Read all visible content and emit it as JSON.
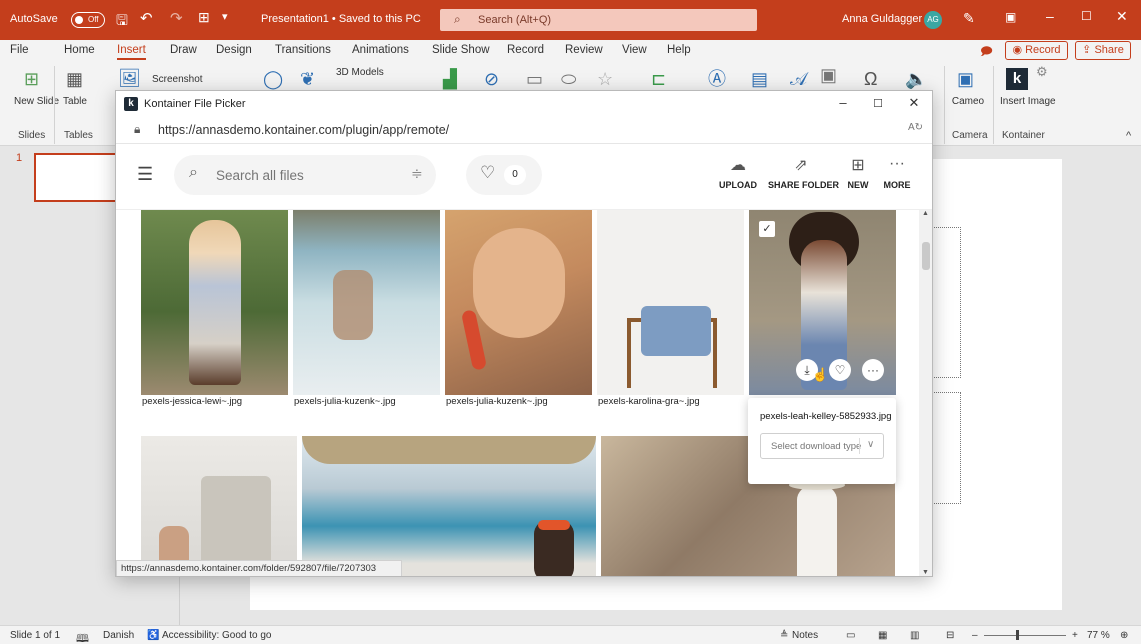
{
  "titlebar": {
    "autosave_label": "AutoSave",
    "autosave_state": "Off",
    "doc_title": "Presentation1 • Saved to this PC",
    "search_placeholder": "Search (Alt+Q)",
    "user_name": "Anna Guldagger",
    "user_initials": "AG"
  },
  "menu": {
    "items": [
      "File",
      "Home",
      "Insert",
      "Draw",
      "Design",
      "Transitions",
      "Animations",
      "Slide Show",
      "Record",
      "Review",
      "View",
      "Help"
    ],
    "active": "Insert",
    "record_label": "Record",
    "share_label": "Share"
  },
  "ribbon": {
    "new_slide": "New Slide",
    "table": "Table",
    "screenshot": "Screenshot",
    "models_3d": "3D Models",
    "cameo": "Cameo",
    "insert_image": "Insert Image",
    "groups": {
      "slides": "Slides",
      "tables": "Tables",
      "camera": "Camera",
      "kontainer": "Kontainer"
    }
  },
  "picker": {
    "window_title": "Kontainer File Picker",
    "url": "https://annasdemo.kontainer.com/plugin/app/remote/",
    "search_placeholder": "Search all files",
    "favorites_count": "0",
    "tools": {
      "upload": "UPLOAD",
      "share_folder": "SHARE FOLDER",
      "new": "NEW",
      "more": "MORE"
    },
    "files": [
      {
        "name": "pexels-jessica-lewi~.jpg"
      },
      {
        "name": "pexels-julia-kuzenk~.jpg"
      },
      {
        "name": "pexels-julia-kuzenk~.jpg"
      },
      {
        "name": "pexels-karolina-gra~.jpg"
      }
    ],
    "popup": {
      "file_name": "pexels-leah-kelley-5852933.jpg",
      "select_placeholder": "Select download type"
    },
    "status_link": "https://annasdemo.kontainer.com/folder/592807/file/7207303"
  },
  "slides": {
    "thumb_number": "1"
  },
  "statusbar": {
    "slide_info": "Slide 1 of 1",
    "language": "Danish",
    "accessibility": "Accessibility: Good to go",
    "notes": "Notes",
    "zoom": "77 %"
  },
  "colors": {
    "accent": "#c43e1c",
    "titlebar": "#c43e1c"
  }
}
